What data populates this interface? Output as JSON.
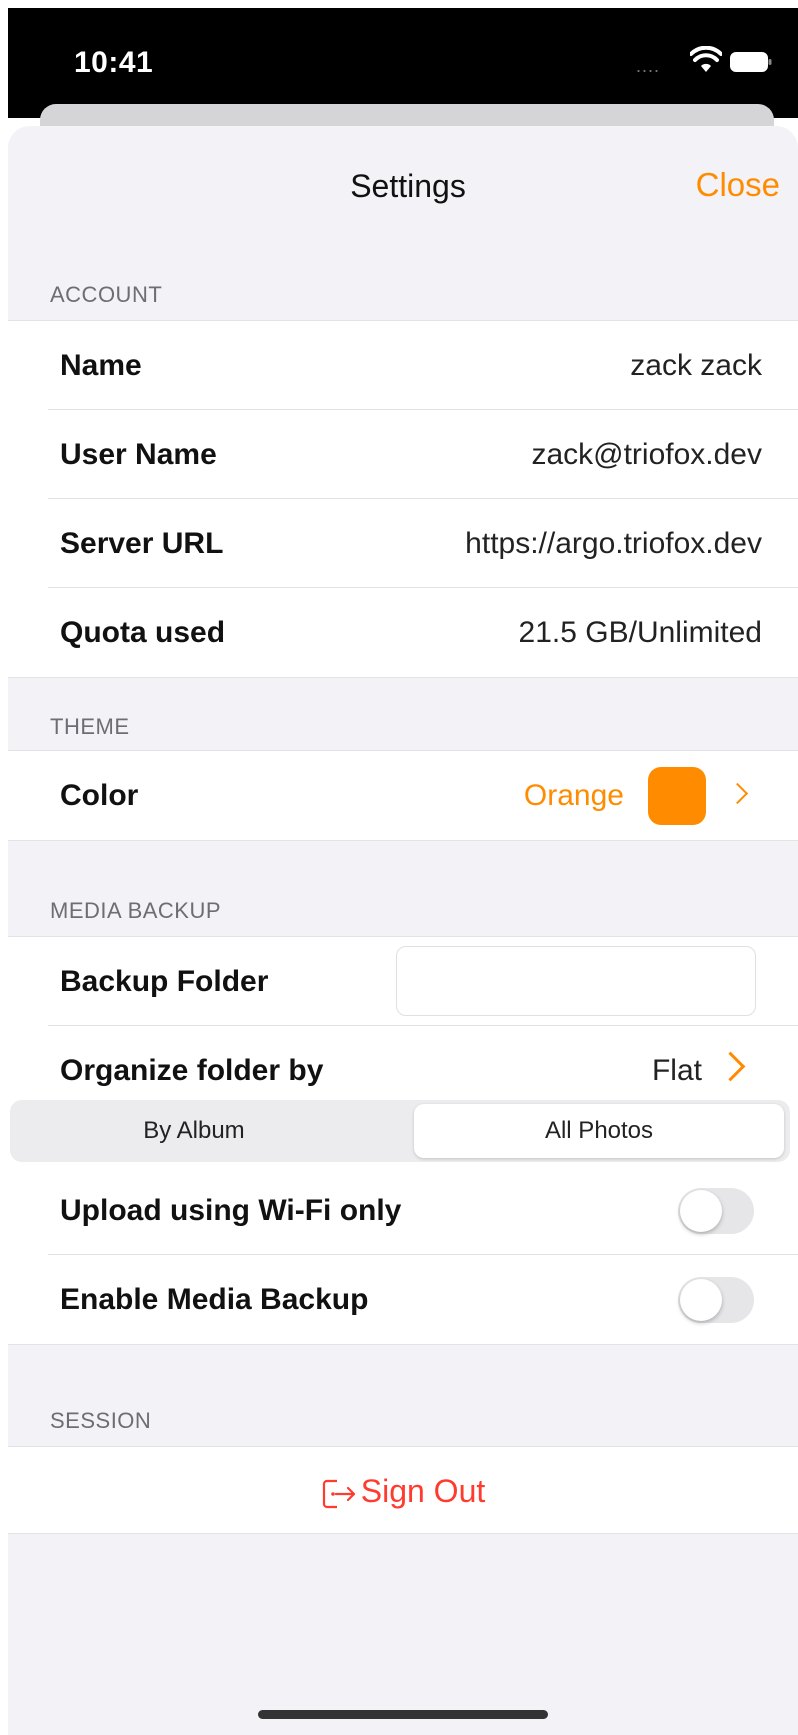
{
  "status_bar": {
    "time": "10:41",
    "signal": "....",
    "wifi_icon": "wifi-icon",
    "battery_icon": "battery-icon"
  },
  "nav": {
    "title": "Settings",
    "close_label": "Close"
  },
  "account": {
    "header": "ACCOUNT",
    "rows": [
      {
        "label": "Name",
        "value": "zack zack"
      },
      {
        "label": "User Name",
        "value": "zack@triofox.dev"
      },
      {
        "label": "Server URL",
        "value": "https://argo.triofox.dev"
      },
      {
        "label": "Quota used",
        "value": "21.5 GB/Unlimited"
      }
    ]
  },
  "theme": {
    "header": "THEME",
    "color_label": "Color",
    "color_value": "Orange",
    "swatch_color": "#ff8c00"
  },
  "media_backup": {
    "header": "MEDIA BACKUP",
    "backup_folder_label": "Backup Folder",
    "backup_folder_value": "",
    "organize_label": "Organize folder by",
    "organize_value": "Flat",
    "segments": [
      "By Album",
      "All Photos"
    ],
    "selected_segment": "All Photos",
    "wifi_only_label": "Upload using Wi-Fi only",
    "wifi_only_on": false,
    "enable_label": "Enable Media Backup",
    "enable_on": false
  },
  "session": {
    "header": "SESSION",
    "sign_out_label": "Sign Out",
    "sign_out_icon": "sign-out-icon"
  },
  "colors": {
    "accent": "#ff8c00",
    "destructive": "#ff3b30",
    "grouped_bg": "#f2f2f7"
  }
}
